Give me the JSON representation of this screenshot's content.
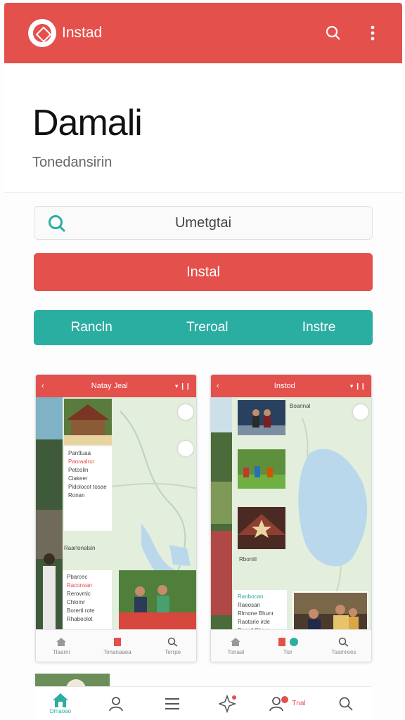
{
  "appbar": {
    "title": "Instad",
    "logo_icon": "logo-icon",
    "search_icon": "search-icon",
    "menu_icon": "more-vert-icon"
  },
  "header": {
    "title": "Damali",
    "subtitle": "Tonedansirin"
  },
  "search": {
    "value": "Umetgtai"
  },
  "install_button": {
    "label": "Instal"
  },
  "tabs": [
    {
      "label": "Rancln"
    },
    {
      "label": "Treroal"
    },
    {
      "label": "Instre"
    }
  ],
  "screenshots": [
    {
      "title": "Natay Jeal",
      "status": "▾ ❙❙",
      "card_top": [
        "Panttuaa",
        "Paoraalrur",
        "Petcolin Ciakeer",
        "Pidolocot tosae",
        "Ronan"
      ],
      "map_label": "Raarlonalsin",
      "card_bottom": [
        "Pbarcec",
        "Raconsan",
        "Rerovmlc Chlomr",
        "Borerti rote",
        "Rhabeolot"
      ],
      "nav": [
        {
          "label": "Tlaarni",
          "icon": "home-icon"
        },
        {
          "label": "Tonanaaea",
          "icon": "book-icon"
        },
        {
          "label": "Terrpe",
          "icon": "search-icon"
        }
      ]
    },
    {
      "title": "Instod",
      "status": "▾ ❙❙",
      "map_label": "Rbonitl",
      "card_top": [
        "Boarinal"
      ],
      "card_bottom": [
        "Ranbocan",
        "Raeosan",
        "Rlmone Bhunr",
        "Raotarie irde",
        "Deaaf Cheer"
      ],
      "nav": [
        {
          "label": "Tonaal",
          "icon": "home-icon"
        },
        {
          "label": "Tisr",
          "icon": "book-icon"
        },
        {
          "label": "Toamrees",
          "icon": "search-icon"
        }
      ]
    }
  ],
  "bottom_nav": {
    "home_label": "Dmaoao",
    "badge_text": "Tnal"
  },
  "colors": {
    "brand": "#e4504b",
    "accent": "#2aaea2"
  }
}
